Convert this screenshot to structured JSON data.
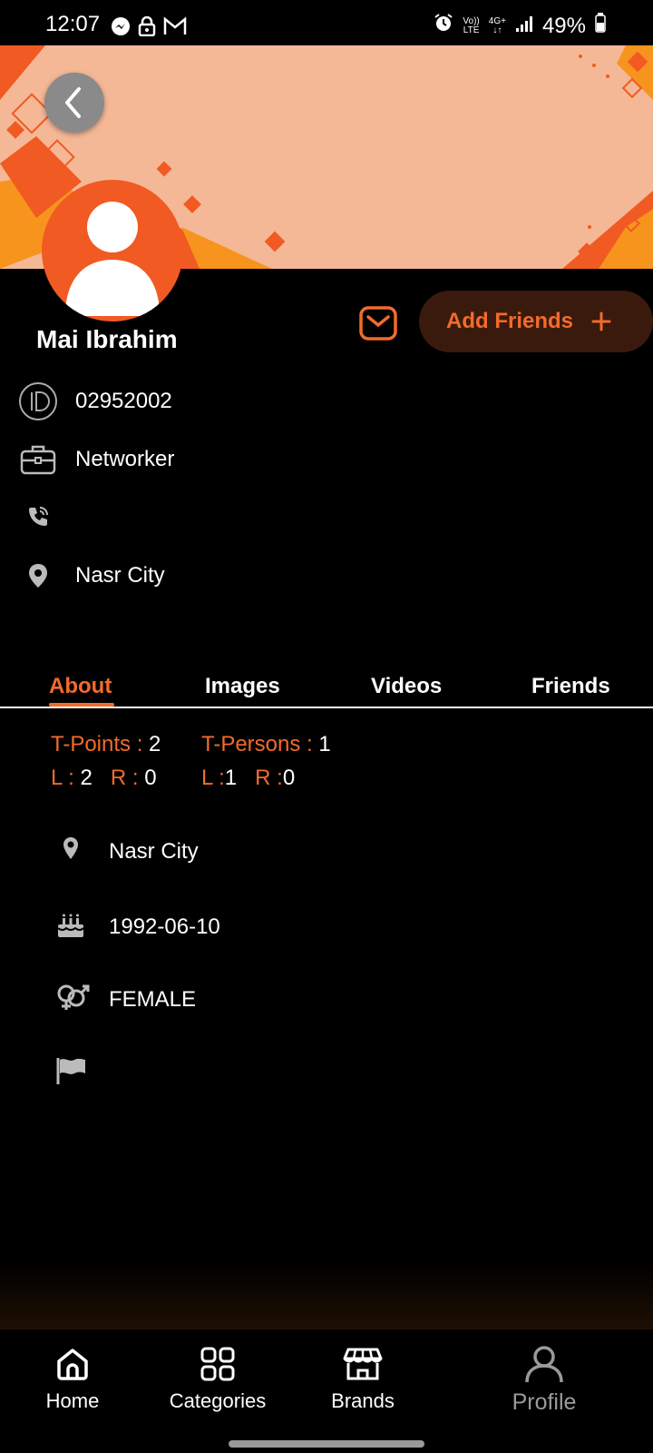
{
  "status_bar": {
    "time": "12:07",
    "volte_top": "Vo))",
    "volte_bottom": "LTE",
    "network": "4G+",
    "battery": "49%",
    "icons": [
      "messenger-icon",
      "lock-icon",
      "gmail-icon",
      "alarm-icon",
      "signal-icon",
      "battery-icon"
    ]
  },
  "profile": {
    "name": "Mai Ibrahim",
    "add_friends_label": "Add Friends",
    "id": "02952002",
    "job": "Networker",
    "phone": "",
    "location": "Nasr City"
  },
  "tabs": [
    {
      "label": "About",
      "active": true
    },
    {
      "label": "Images",
      "active": false
    },
    {
      "label": "Videos",
      "active": false
    },
    {
      "label": "Friends",
      "active": false
    }
  ],
  "stats": {
    "t_points_label": "T-Points :",
    "t_points_value": "2",
    "t_persons_label": "T-Persons :",
    "t_persons_value": "1",
    "left_l_label": "L :",
    "left_l_value": "2",
    "left_r_label": "R :",
    "left_r_value": "0",
    "right_l_label": "L :",
    "right_l_value": "1",
    "right_r_label": "R :",
    "right_r_value": "0"
  },
  "about": {
    "location": "Nasr City",
    "birthday": "1992-06-10",
    "gender": "FEMALE",
    "country": ""
  },
  "bottom_nav": [
    {
      "label": "Home",
      "icon": "home-icon"
    },
    {
      "label": "Categories",
      "icon": "categories-icon"
    },
    {
      "label": "Brands",
      "icon": "store-icon"
    },
    {
      "label": "Profile",
      "icon": "profile-icon",
      "active": true
    }
  ],
  "colors": {
    "accent": "#f26b2b",
    "banner_bg": "#f5b896",
    "avatar_bg": "#f15a22",
    "add_button_bg": "#3a1a0c"
  }
}
